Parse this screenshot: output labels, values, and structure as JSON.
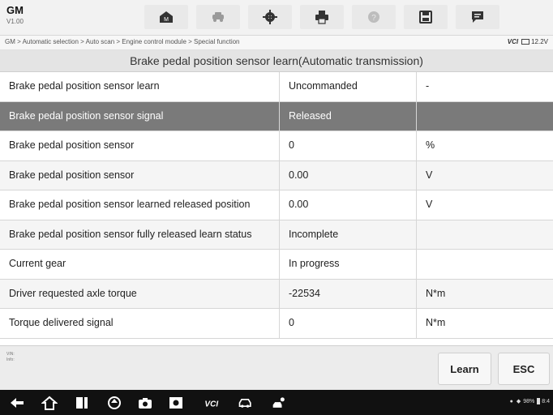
{
  "brand": {
    "name": "GM",
    "version": "V1.00"
  },
  "toolbar": {
    "icons": [
      "home-icon",
      "vehicle-swap-icon",
      "settings-icon",
      "print-icon",
      "help-icon",
      "save-icon",
      "message-icon"
    ]
  },
  "breadcrumb": "GM > Automatic selection > Auto scan > Engine control module > Special function",
  "status": {
    "vci": "VCI",
    "voltage": "12.2V"
  },
  "title": "Brake pedal position sensor learn(Automatic transmission)",
  "rows": [
    {
      "name": "Brake pedal position sensor learn",
      "value": "Uncommanded",
      "unit": "-"
    },
    {
      "name": "Brake pedal position sensor signal",
      "value": "Released",
      "unit": ""
    },
    {
      "name": "Brake pedal position sensor",
      "value": "0",
      "unit": "%"
    },
    {
      "name": "Brake pedal position sensor",
      "value": "0.00",
      "unit": "V"
    },
    {
      "name": "Brake pedal position sensor learned released position",
      "value": "0.00",
      "unit": "V"
    },
    {
      "name": "Brake pedal position sensor fully released learn status",
      "value": "Incomplete",
      "unit": ""
    },
    {
      "name": "Current gear",
      "value": "In progress",
      "unit": ""
    },
    {
      "name": "Driver requested axle torque",
      "value": "-22534",
      "unit": "N*m"
    },
    {
      "name": "Torque delivered signal",
      "value": "0",
      "unit": "N*m"
    }
  ],
  "footer": {
    "vin_label": "VIN:",
    "info_label": "Info:",
    "learn_label": "Learn",
    "esc_label": "ESC"
  },
  "system": {
    "battery": "98%",
    "time": "8:4"
  },
  "colors": {
    "selected_row": "#7a7a7a",
    "nav_bar": "#111111",
    "title_bar": "#e4e4e4"
  }
}
